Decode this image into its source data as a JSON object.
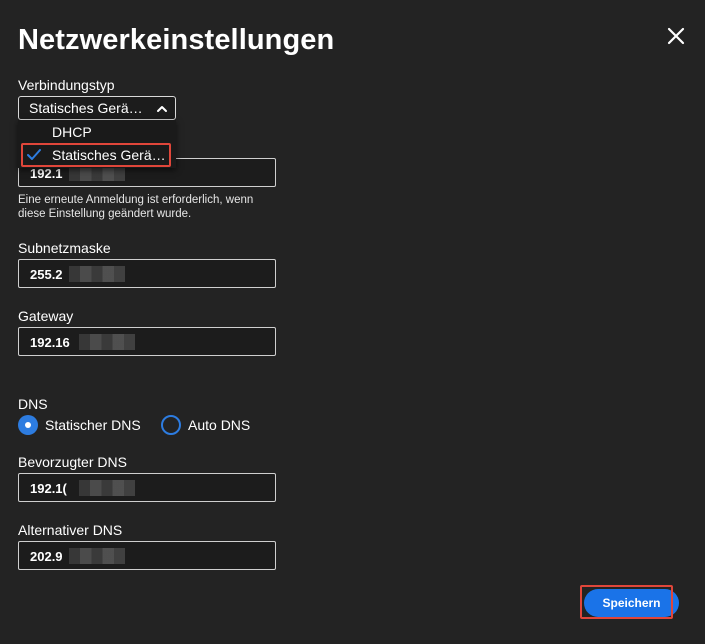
{
  "dialog": {
    "title": "Netzwerkeinstellungen",
    "close_icon": "close-icon"
  },
  "connection_type": {
    "label": "Verbindungstyp",
    "selected": "Statisches Gerä…",
    "options": [
      {
        "label": "DHCP",
        "selected": false
      },
      {
        "label": "Statisches Gerä…",
        "selected": true
      }
    ]
  },
  "ip_address": {
    "value": "192.1",
    "hint": "Eine erneute Anmeldung ist erforderlich, wenn diese Einstellung geändert wurde."
  },
  "subnet": {
    "label": "Subnetzmaske",
    "value": "255.2"
  },
  "gateway": {
    "label": "Gateway",
    "value": "192.16"
  },
  "dns": {
    "label": "DNS",
    "options": [
      {
        "label": "Statischer DNS",
        "selected": true
      },
      {
        "label": "Auto DNS",
        "selected": false
      }
    ]
  },
  "preferred_dns": {
    "label": "Bevorzugter DNS",
    "value": "192.1("
  },
  "alternate_dns": {
    "label": "Alternativer DNS",
    "value": "202.9"
  },
  "actions": {
    "save_label": "Speichern"
  },
  "colors": {
    "background": "#232323",
    "accent": "#1a73e8",
    "highlight": "#e0463a"
  }
}
